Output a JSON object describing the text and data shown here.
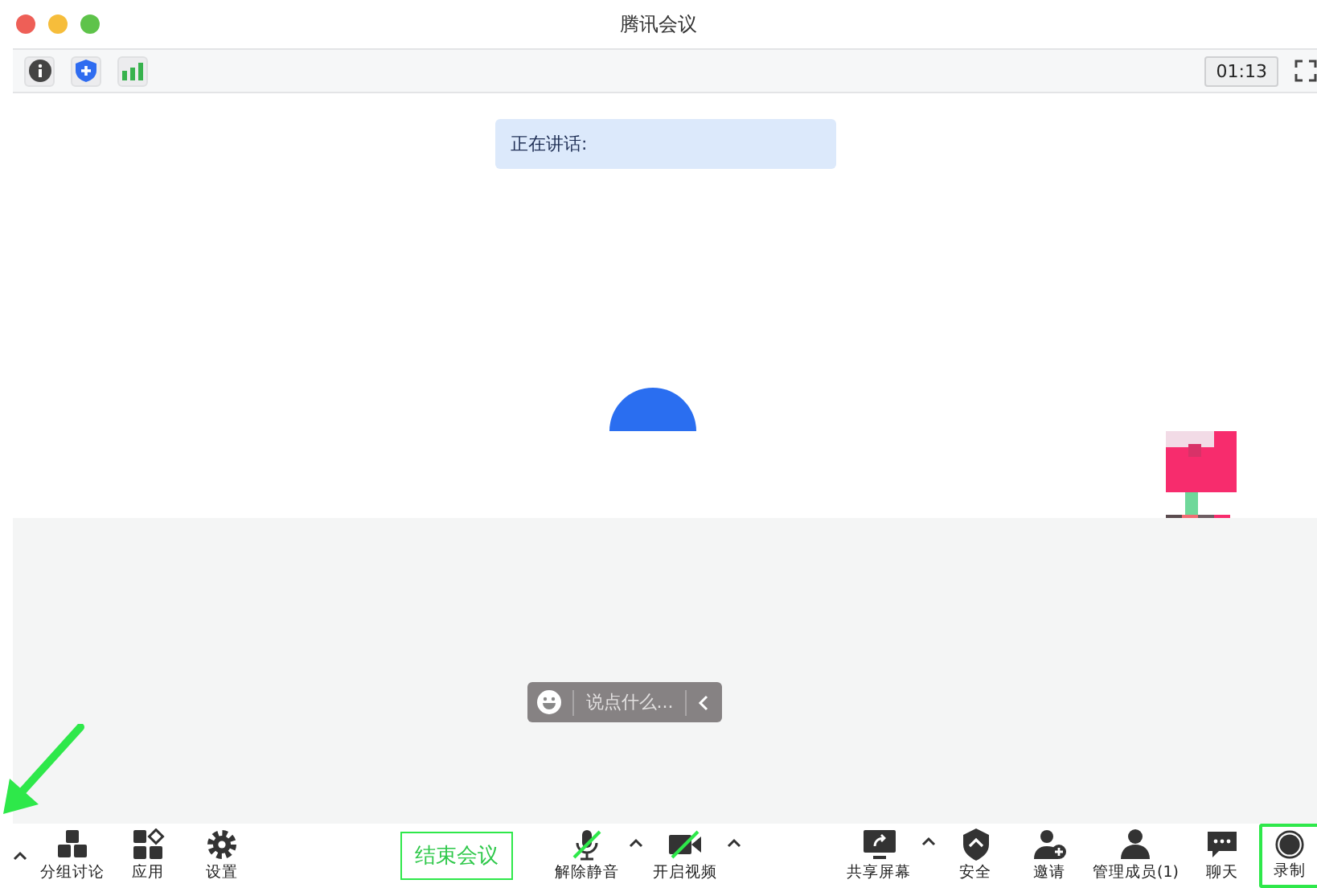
{
  "window": {
    "title": "腾讯会议"
  },
  "info_bar": {
    "timer": "01:13"
  },
  "speaking": {
    "label": "正在讲话:"
  },
  "chat_input": {
    "placeholder": "说点什么..."
  },
  "toolbar": {
    "left": [
      {
        "label": "分组讨论",
        "has_menu": false,
        "slashed": false,
        "highlighted": false
      },
      {
        "label": "应用",
        "has_menu": false,
        "slashed": false,
        "highlighted": false
      },
      {
        "label": "设置",
        "has_menu": false,
        "slashed": false,
        "highlighted": false
      }
    ],
    "end_button": "结束会议",
    "center": [
      {
        "label": "解除静音",
        "has_menu": true,
        "slashed": true,
        "highlighted": false
      },
      {
        "label": "开启视频",
        "has_menu": true,
        "slashed": true,
        "highlighted": false
      }
    ],
    "right": [
      {
        "label": "共享屏幕",
        "has_menu": true,
        "slashed": false,
        "highlighted": false
      },
      {
        "label": "安全",
        "has_menu": false,
        "slashed": false,
        "highlighted": false
      },
      {
        "label": "邀请",
        "has_menu": false,
        "slashed": false,
        "highlighted": false
      },
      {
        "label": "管理成员(1)",
        "has_menu": false,
        "slashed": false,
        "highlighted": false
      },
      {
        "label": "聊天",
        "has_menu": false,
        "slashed": false,
        "highlighted": false
      },
      {
        "label": "录制",
        "has_menu": false,
        "slashed": false,
        "highlighted": true
      }
    ]
  }
}
